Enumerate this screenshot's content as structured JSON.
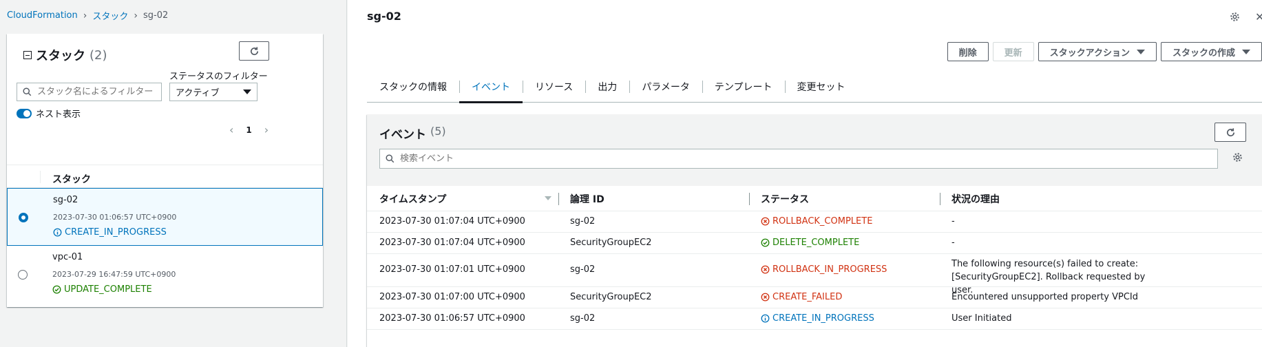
{
  "breadcrumb": {
    "root": "CloudFormation",
    "section": "スタック",
    "current": "sg-02"
  },
  "stacks_panel": {
    "title": "スタック",
    "count": "(2)",
    "status_filter_label": "ステータスのフィルター",
    "search_placeholder": "スタック名によるフィルター",
    "status_filter_value": "アクティブ",
    "nested_toggle_label": "ネスト表示",
    "page": "1",
    "column_header": "スタック",
    "stacks": [
      {
        "name": "sg-02",
        "date": "2023-07-30 01:06:57 UTC+0900",
        "status": "CREATE_IN_PROGRESS",
        "status_type": "info",
        "selected": true
      },
      {
        "name": "vpc-01",
        "date": "2023-07-29 16:47:59 UTC+0900",
        "status": "UPDATE_COMPLETE",
        "status_type": "ok",
        "selected": false
      }
    ]
  },
  "detail": {
    "title": "sg-02",
    "actions": {
      "delete": "削除",
      "update": "更新",
      "stack_actions": "スタックアクション",
      "create_stack": "スタックの作成"
    },
    "tabs": [
      "スタックの情報",
      "イベント",
      "リソース",
      "出力",
      "パラメータ",
      "テンプレート",
      "変更セット"
    ],
    "active_tab": "イベント",
    "events": {
      "title": "イベント",
      "count": "(5)",
      "search_placeholder": "検索イベント",
      "columns": [
        "タイムスタンプ",
        "論理 ID",
        "ステータス",
        "状況の理由"
      ],
      "rows": [
        {
          "timestamp": "2023-07-30 01:07:04 UTC+0900",
          "logical_id": "sg-02",
          "status": "ROLLBACK_COMPLETE",
          "status_type": "err",
          "reason": "-"
        },
        {
          "timestamp": "2023-07-30 01:07:04 UTC+0900",
          "logical_id": "SecurityGroupEC2",
          "status": "DELETE_COMPLETE",
          "status_type": "ok",
          "reason": "-"
        },
        {
          "timestamp": "2023-07-30 01:07:01 UTC+0900",
          "logical_id": "sg-02",
          "status": "ROLLBACK_IN_PROGRESS",
          "status_type": "err",
          "reason": "The following resource(s) failed to create: [SecurityGroupEC2]. Rollback requested by user."
        },
        {
          "timestamp": "2023-07-30 01:07:00 UTC+0900",
          "logical_id": "SecurityGroupEC2",
          "status": "CREATE_FAILED",
          "status_type": "err",
          "reason": "Encountered unsupported property VPCId"
        },
        {
          "timestamp": "2023-07-30 01:06:57 UTC+0900",
          "logical_id": "sg-02",
          "status": "CREATE_IN_PROGRESS",
          "status_type": "info",
          "reason": "User Initiated"
        }
      ]
    }
  },
  "colors": {
    "accent": "#0073bb",
    "success": "#1d8102",
    "error": "#d13212",
    "border": "#aab7b8"
  },
  "icons": {
    "refresh": "refresh-icon",
    "search": "search-icon",
    "settings": "gear-icon",
    "info": "info-circle-icon",
    "success": "check-circle-icon",
    "error": "x-circle-icon"
  }
}
